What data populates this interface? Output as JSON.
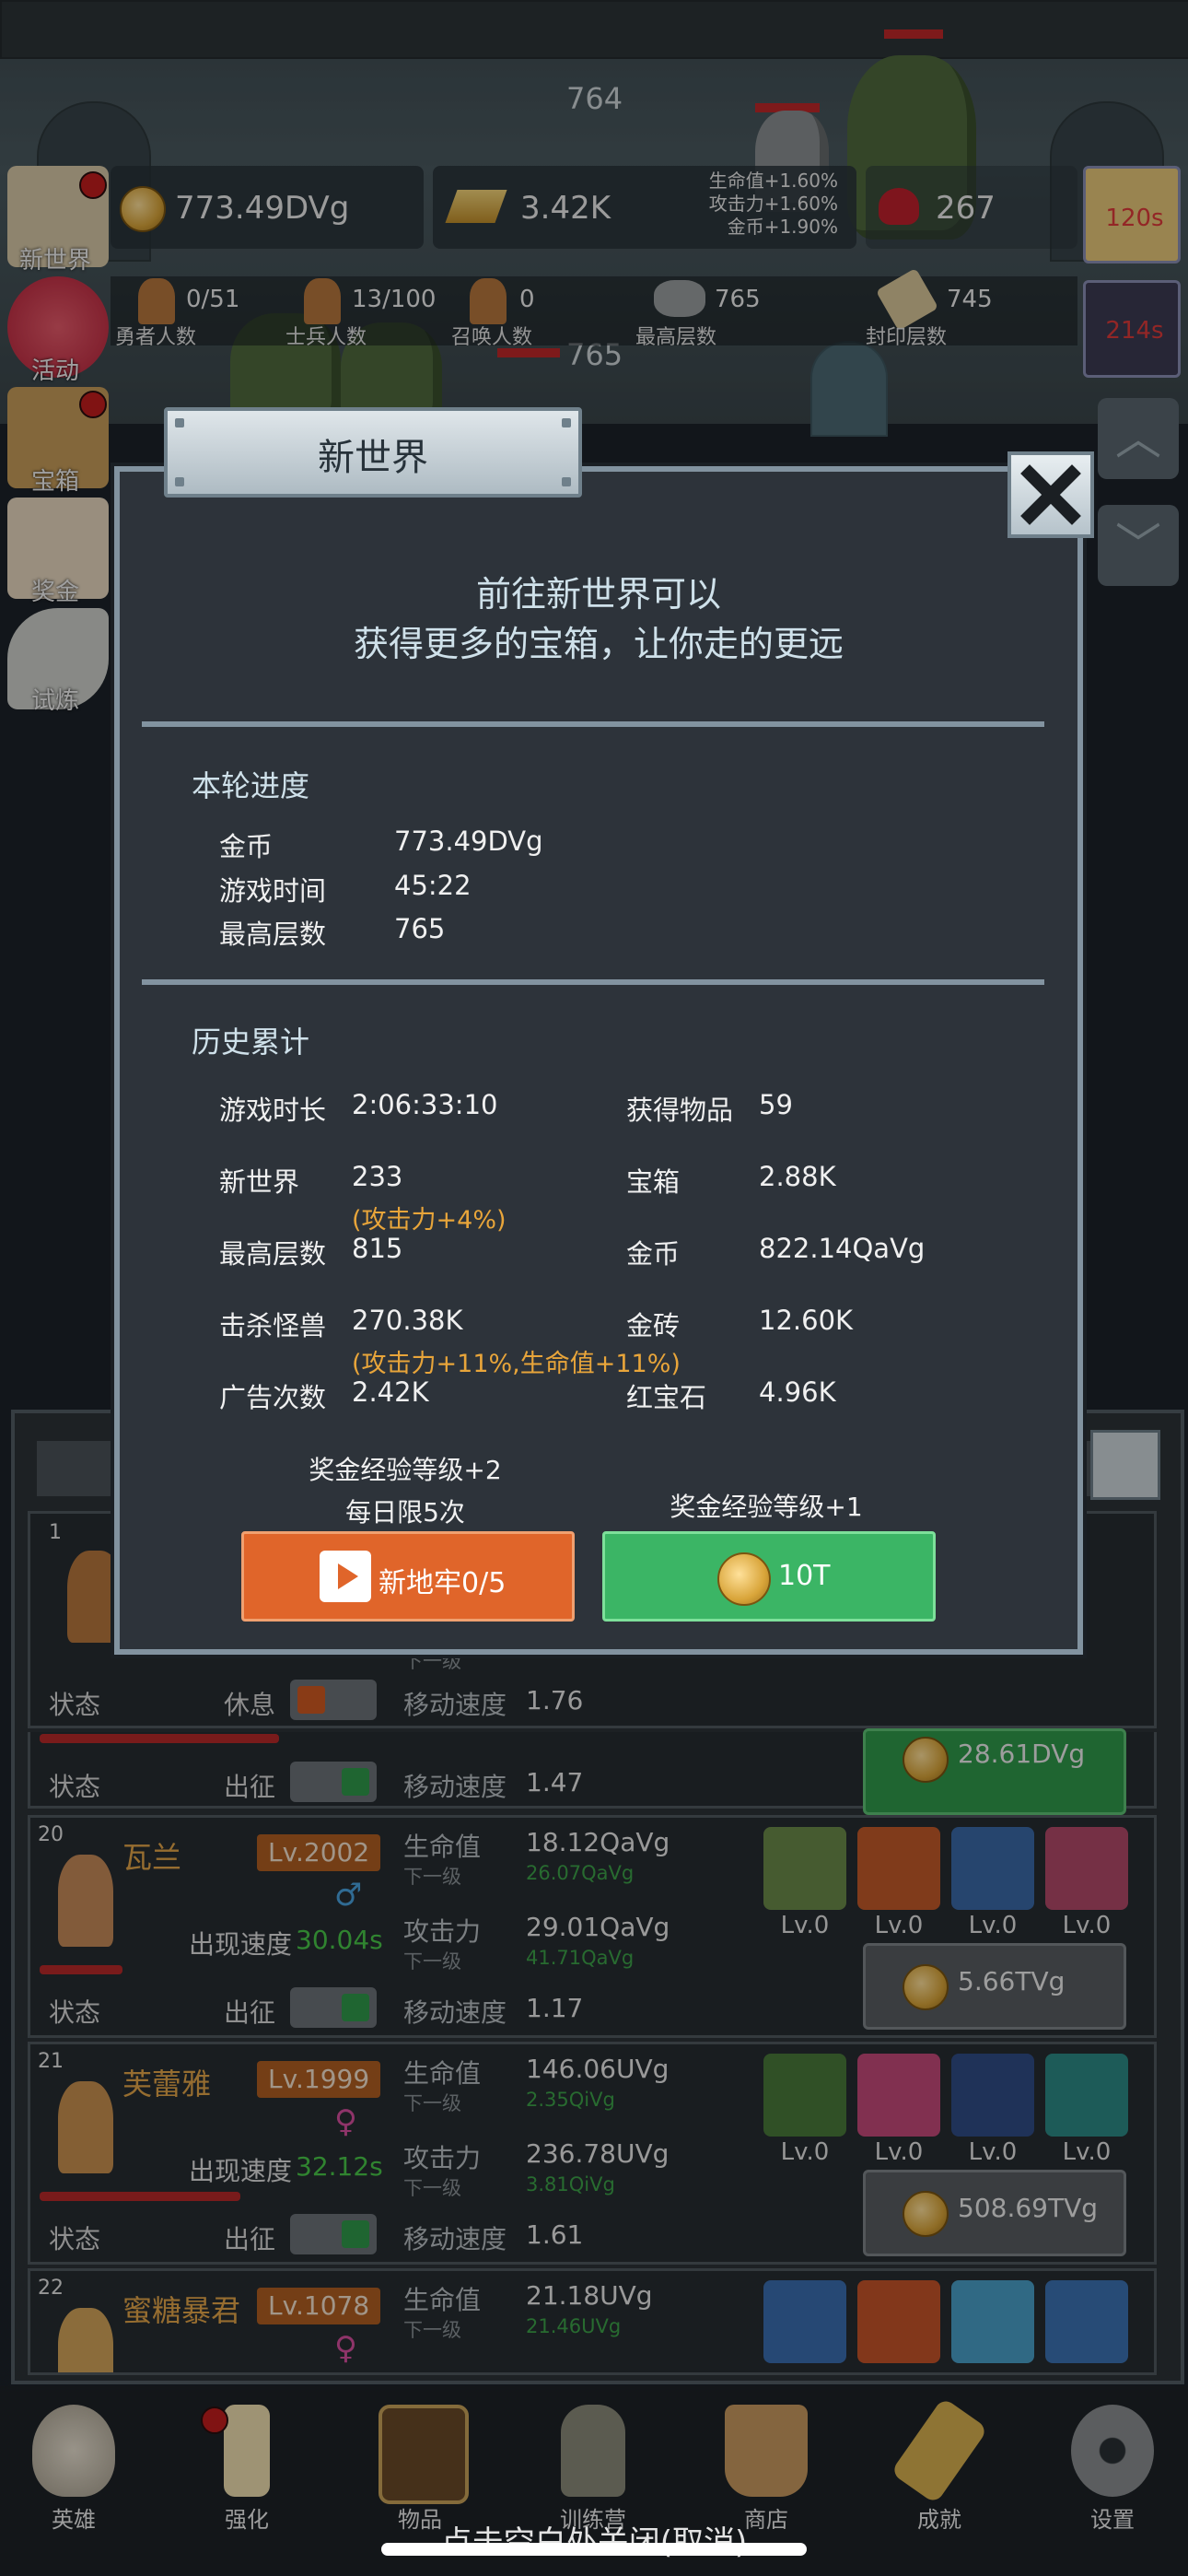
{
  "top_hud": {
    "floor_top": "764",
    "gold": "773.49DVg",
    "gold_bars": "3.42K",
    "bonus_hp": "生命值+1.60%",
    "bonus_atk": "攻击力+1.60%",
    "bonus_gold": "金币+1.90%",
    "ruby": "267",
    "timer1": "120s",
    "timer2": "214s",
    "floor_enemy": "765"
  },
  "stats_bar": {
    "heroes_value": "0/51",
    "heroes_label": "勇者人数",
    "soldiers_value": "13/100",
    "soldiers_label": "士兵人数",
    "summons_value": "0",
    "summons_label": "召唤人数",
    "max_floor_value": "765",
    "max_floor_label": "最高层数",
    "sealed_value": "745",
    "sealed_label": "封印层数"
  },
  "side_menu": [
    {
      "label": "新世界"
    },
    {
      "label": "活动"
    },
    {
      "label": "宝箱"
    },
    {
      "label": "奖金"
    },
    {
      "label": "试炼"
    }
  ],
  "modal": {
    "title": "新世界",
    "intro_line1": "前往新世界可以",
    "intro_line2": "获得更多的宝箱，让你走的更远",
    "round_title": "本轮进度",
    "round": [
      {
        "label": "金币",
        "value": "773.49DVg"
      },
      {
        "label": "游戏时间",
        "value": "45:22"
      },
      {
        "label": "最高层数",
        "value": "765"
      }
    ],
    "history_title": "历史累计",
    "history_left": [
      {
        "label": "游戏时长",
        "value": "2:06:33:10",
        "bonus": ""
      },
      {
        "label": "新世界",
        "value": "233",
        "bonus": "(攻击力+4%)"
      },
      {
        "label": "最高层数",
        "value": "815",
        "bonus": ""
      },
      {
        "label": "击杀怪兽",
        "value": "270.38K",
        "bonus": "(攻击力+11%,生命值+11%)"
      },
      {
        "label": "广告次数",
        "value": "2.42K",
        "bonus": ""
      }
    ],
    "history_right": [
      {
        "label": "获得物品",
        "value": "59"
      },
      {
        "label": "宝箱",
        "value": "2.88K"
      },
      {
        "label": "金币",
        "value": "822.14QaVg"
      },
      {
        "label": "金砖",
        "value": "12.60K"
      },
      {
        "label": "红宝石",
        "value": "4.96K"
      }
    ],
    "left_note_line1": "奖金经验等级+2",
    "left_note_line2": "每日限5次",
    "right_note": "奖金经验等级+1",
    "left_button": "新地牢0/5",
    "right_button": "10T"
  },
  "hero_panel": {
    "status_label": "状态",
    "rest_label": "休息",
    "deploy_label": "出征",
    "move_speed_label": "移动速度",
    "hp_label": "生命值",
    "atk_label": "攻击力",
    "next_label": "下一级",
    "spawn_label": "出现速度",
    "lv0": "Lv.0",
    "card1": {
      "index": "1",
      "next_partial": "下一级",
      "move_speed": "1.76"
    },
    "card2": {
      "move_speed": "1.47",
      "upgrade_cost": "28.61DVg"
    },
    "card3": {
      "index": "20",
      "name": "瓦兰",
      "level": "Lv.2002",
      "hp": "18.12QaVg",
      "hp_next": "26.07QaVg",
      "atk": "29.01QaVg",
      "atk_next": "41.71QaVg",
      "move_speed": "1.17",
      "spawn_speed": "30.04s",
      "upgrade_cost": "5.66TVg",
      "gender": "♂"
    },
    "card4": {
      "index": "21",
      "name": "芙蕾雅",
      "level": "Lv.1999",
      "hp": "146.06UVg",
      "hp_next": "2.35QiVg",
      "atk": "236.78UVg",
      "atk_next": "3.81QiVg",
      "move_speed": "1.61",
      "spawn_speed": "32.12s",
      "upgrade_cost": "508.69TVg",
      "gender": "♀"
    },
    "card5": {
      "index": "22",
      "name": "蜜糖暴君",
      "level": "Lv.1078",
      "hp": "21.18UVg",
      "hp_next": "21.46UVg",
      "gender": "♀"
    }
  },
  "bottom_nav": [
    {
      "label": "英雄"
    },
    {
      "label": "强化"
    },
    {
      "label": "物品"
    },
    {
      "label": "训练营"
    },
    {
      "label": "商店"
    },
    {
      "label": "成就"
    },
    {
      "label": "设置"
    }
  ],
  "tap_close": "点击空白处关闭(取消)",
  "colors": {
    "orange_button": "#e0652a",
    "green_button": "#3bb565",
    "modal_border": "#8293a0",
    "bonus_text": "#e8a53a"
  }
}
